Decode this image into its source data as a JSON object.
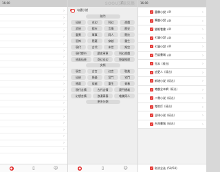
{
  "status_bar": {
    "time": "16:00",
    "center_left": "16:00",
    "center_right": "16:00",
    "watermark": "SOOU文章采集"
  },
  "panel2": {
    "header_label": "勾選小說",
    "section1": "熱門",
    "grid1": [
      "仙俠",
      "玄幻",
      "科幻",
      "遊戲",
      "武俠",
      "都市",
      "言情",
      "歷史",
      "靈異",
      "軍事",
      "同人",
      "競技",
      "恐怖",
      "懸疑",
      "穿越",
      "重生",
      "現代",
      "古代",
      "末世",
      "架空"
    ],
    "grid1_wide": [
      "現代都市",
      "歷史軍事",
      "科幻遊戲",
      "修真仙俠",
      "奇幻玄幻",
      "懸疑推理"
    ],
    "section2": "女頻",
    "grid2": [
      "現言",
      "古言",
      "幻言",
      "耽美",
      "仙俠",
      "懸疑",
      "宮鬥",
      "宅鬥",
      "總裁",
      "穿越",
      "重生",
      "青春",
      "校園",
      "豪門",
      "種田"
    ],
    "grid2_wide": [
      "現代言情",
      "古代言情",
      "豪門總裁",
      "幻想言情",
      "浪漫青春",
      "唯美同人"
    ],
    "footer_pill": "更多分類"
  },
  "panel3": {
    "items": [
      {
        "name": "墨霖小說",
        "tag": "API"
      },
      {
        "name": "筆趣小說",
        "tag": "API"
      },
      {
        "name": "猫眼看書",
        "tag": "API"
      },
      {
        "name": "七貓小說",
        "tag": "API"
      },
      {
        "name": "七貓小說",
        "tag": "API"
      },
      {
        "name": "百度書城",
        "tag": "API"
      },
      {
        "name": "完本",
        "tag": "(精选)"
      },
      {
        "name": "追更人",
        "tag": "(精选)"
      },
      {
        "name": "新增小说",
        "tag": "(精选)"
      },
      {
        "name": "笔趣全本網",
        "tag": "(精选)"
      },
      {
        "name": "八零小说",
        "tag": "(精选)"
      },
      {
        "name": "鬼吹灯",
        "tag": "(精选)"
      },
      {
        "name": "全球小说",
        "tag": "(精选)"
      },
      {
        "name": "台灣書城",
        "tag": "(精选)"
      }
    ],
    "bottom_label": "取消全选",
    "bottom_count": "(58/58)"
  }
}
